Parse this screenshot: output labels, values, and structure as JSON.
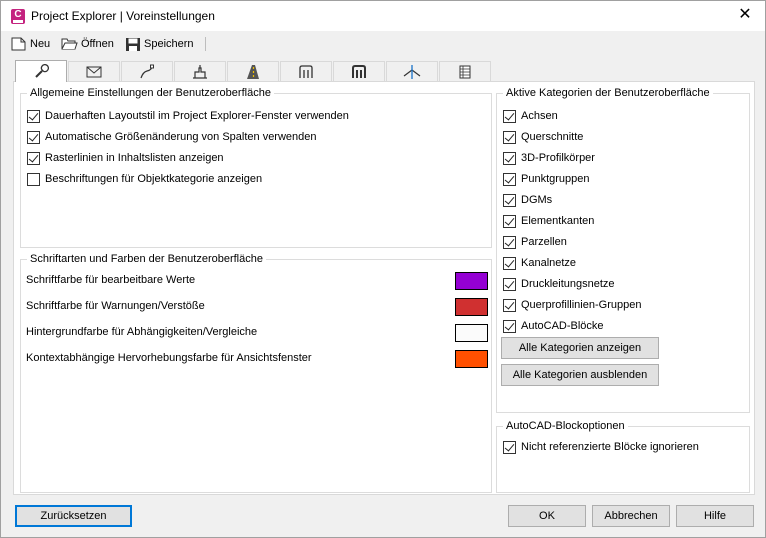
{
  "window": {
    "title": "Project Explorer | Voreinstellungen",
    "app_icon_letter": "C"
  },
  "toolbar": {
    "new_label": "Neu",
    "open_label": "Öffnen",
    "save_label": "Speichern"
  },
  "tabs": [
    {
      "icon": "wrench-icon"
    },
    {
      "icon": "envelope-icon"
    },
    {
      "icon": "alignment-icon"
    },
    {
      "icon": "profile-icon"
    },
    {
      "icon": "corridor-icon"
    },
    {
      "icon": "pipe-network-icon"
    },
    {
      "icon": "pressure-network-icon"
    },
    {
      "icon": "sample-line-icon"
    },
    {
      "icon": "table-icon"
    }
  ],
  "general": {
    "legend": "Allgemeine Einstellungen der Benutzeroberfläche",
    "options": [
      {
        "label": "Dauerhaften Layoutstil im Project Explorer-Fenster verwenden",
        "checked": true
      },
      {
        "label": "Automatische Größenänderung von Spalten verwenden",
        "checked": true
      },
      {
        "label": "Rasterlinien in Inhaltslisten anzeigen",
        "checked": true
      },
      {
        "label": "Beschriftungen für Objektkategorie anzeigen",
        "checked": false
      }
    ]
  },
  "fonts_colors": {
    "legend": "Schriftarten und Farben der Benutzeroberfläche",
    "rows": [
      {
        "label": "Schriftfarbe für bearbeitbare Werte",
        "color": "#9400d3"
      },
      {
        "label": "Schriftfarbe für Warnungen/Verstöße",
        "color": "#d03030"
      },
      {
        "label": "Hintergrundfarbe für Abhängigkeiten/Vergleiche",
        "color": "#fbfbfb"
      },
      {
        "label": "Kontextabhängige Hervorhebungsfarbe für Ansichtsfenster",
        "color": "#ff5000"
      }
    ]
  },
  "categories": {
    "legend": "Aktive Kategorien der Benutzeroberfläche",
    "items": [
      {
        "label": "Achsen",
        "checked": true
      },
      {
        "label": "Querschnitte",
        "checked": true
      },
      {
        "label": "3D-Profilkörper",
        "checked": true
      },
      {
        "label": "Punktgruppen",
        "checked": true
      },
      {
        "label": "DGMs",
        "checked": true
      },
      {
        "label": "Elementkanten",
        "checked": true
      },
      {
        "label": "Parzellen",
        "checked": true
      },
      {
        "label": "Kanalnetze",
        "checked": true
      },
      {
        "label": "Druckleitungsnetze",
        "checked": true
      },
      {
        "label": "Querprofillinien-Gruppen",
        "checked": true
      },
      {
        "label": "AutoCAD-Blöcke",
        "checked": true
      }
    ],
    "show_all_label": "Alle Kategorien anzeigen",
    "hide_all_label": "Alle Kategorien ausblenden"
  },
  "block_options": {
    "legend": "AutoCAD-Blockoptionen",
    "options": [
      {
        "label": "Nicht referenzierte Blöcke ignorieren",
        "checked": true
      }
    ]
  },
  "footer": {
    "reset_label": "Zurücksetzen",
    "ok_label": "OK",
    "cancel_label": "Abbrechen",
    "help_label": "Hilfe"
  },
  "colors": {
    "accent": "#0078d7"
  }
}
